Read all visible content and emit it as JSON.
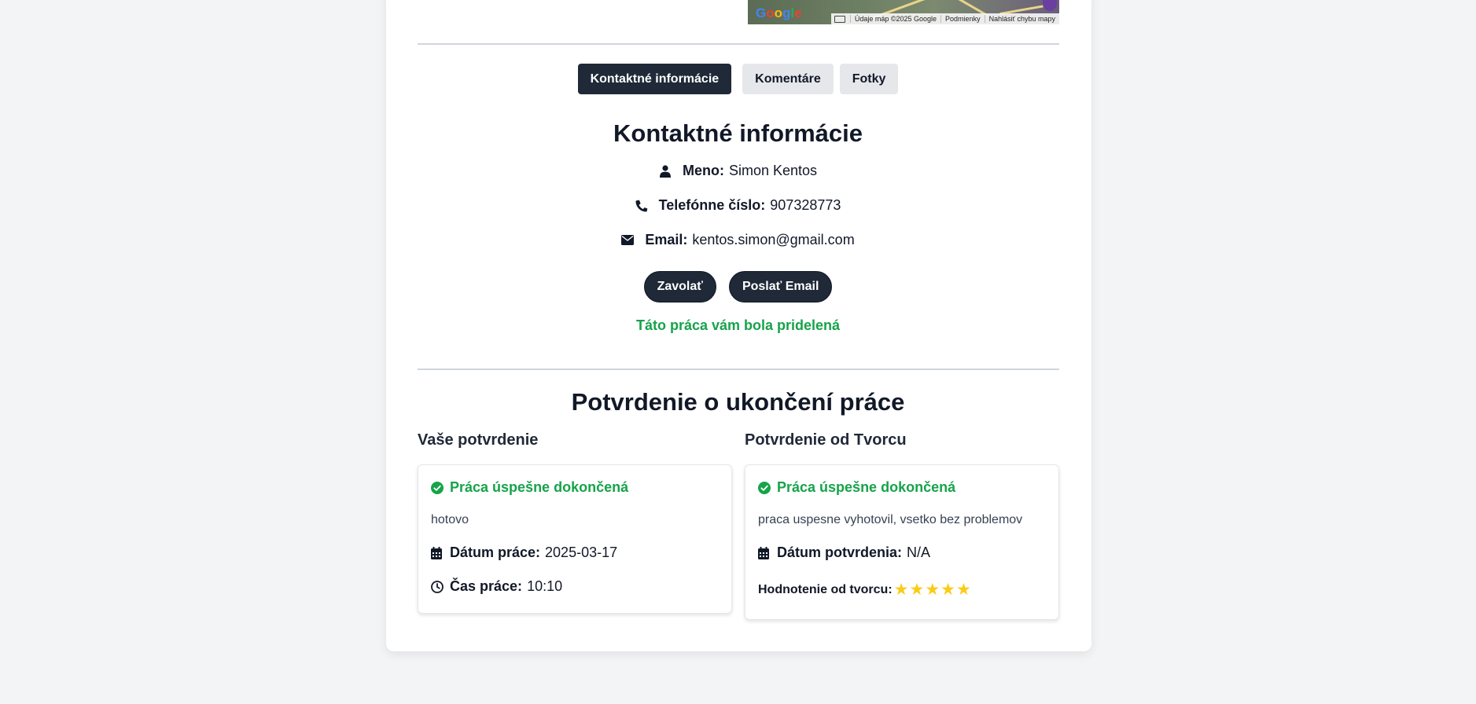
{
  "map": {
    "logo": "Google",
    "attribution": [
      "Údaje máp ©2025 Google",
      "Podmienky",
      "Nahlásiť chybu mapy"
    ]
  },
  "tabs": [
    {
      "label": "Kontaktné informácie",
      "active": true
    },
    {
      "label": "Komentáre",
      "active": false
    },
    {
      "label": "Fotky",
      "active": false
    }
  ],
  "contact": {
    "heading": "Kontaktné informácie",
    "name_label": "Meno:",
    "name_value": "Simon Kentos",
    "phone_label": "Telefónne číslo:",
    "phone_value": "907328773",
    "email_label": "Email:",
    "email_value": "kentos.simon@gmail.com",
    "call_button": "Zavolať",
    "email_button": "Poslať Email",
    "assigned_text": "Táto práca vám bola pridelená"
  },
  "confirmation": {
    "heading": "Potvrdenie o ukončení práce",
    "yours": {
      "title": "Vaše potvrdenie",
      "status": "Práca úspešne dokončená",
      "note": "hotovo",
      "date_label": "Dátum práce:",
      "date_value": "2025-03-17",
      "time_label": "Čas práce:",
      "time_value": "10:10"
    },
    "creator": {
      "title": "Potvrdenie od Tvorcu",
      "status": "Práca úspešne dokončená",
      "note": "praca uspesne vyhotovil, vsetko bez problemov",
      "date_label": "Dátum potvrdenia:",
      "date_value": "N/A",
      "rating_label": "Hodnotenie od tvorcu:",
      "rating": 5
    }
  },
  "colors": {
    "primary": "#1f2937",
    "success": "#16a34a",
    "star": "#facc15",
    "background": "#f3f4f6"
  }
}
